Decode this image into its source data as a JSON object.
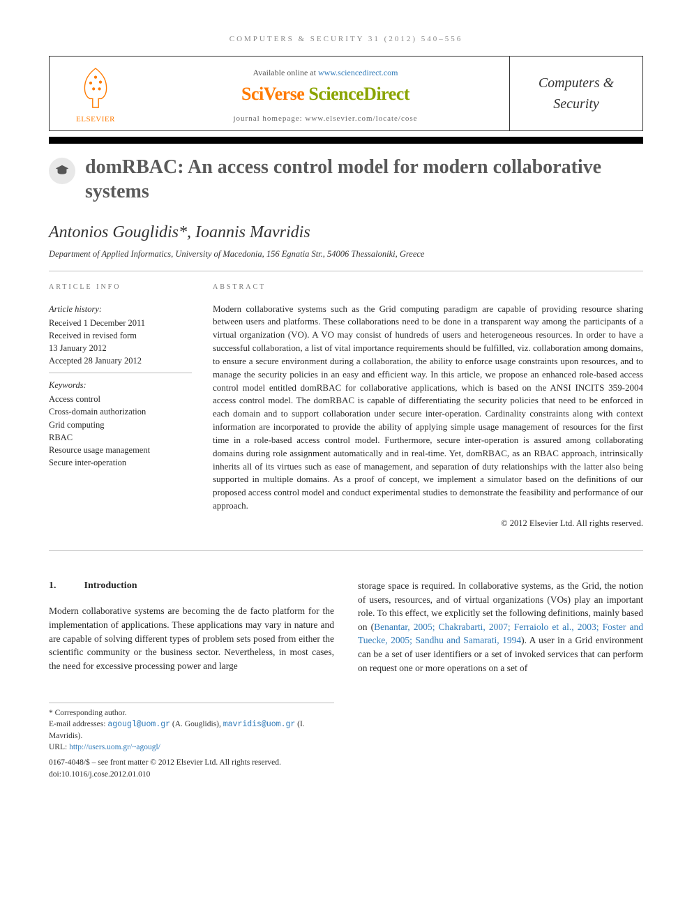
{
  "running_head": "COMPUTERS & SECURITY 31 (2012) 540–556",
  "header": {
    "available_prefix": "Available online at ",
    "available_link": "www.sciencedirect.com",
    "brand_left": "SciVerse ",
    "brand_right": "ScienceDirect",
    "homepage": "journal homepage: www.elsevier.com/locate/cose",
    "publisher_label": "ELSEVIER",
    "journal_name": "Computers & Security"
  },
  "title": "domRBAC: An access control model for modern collaborative systems",
  "authors_line": "Antonios Gouglidis*, Ioannis Mavridis",
  "affiliation": "Department of Applied Informatics, University of Macedonia, 156 Egnatia Str., 54006 Thessaloniki, Greece",
  "labels": {
    "article_info": "ARTICLE INFO",
    "abstract": "ABSTRACT",
    "history": "Article history:",
    "keywords": "Keywords:"
  },
  "history": {
    "received": "Received 1 December 2011",
    "revised_label": "Received in revised form",
    "revised_date": "13 January 2012",
    "accepted": "Accepted 28 January 2012"
  },
  "keywords": [
    "Access control",
    "Cross-domain authorization",
    "Grid computing",
    "RBAC",
    "Resource usage management",
    "Secure inter-operation"
  ],
  "abstract": "Modern collaborative systems such as the Grid computing paradigm are capable of providing resource sharing between users and platforms. These collaborations need to be done in a transparent way among the participants of a virtual organization (VO). A VO may consist of hundreds of users and heterogeneous resources. In order to have a successful collaboration, a list of vital importance requirements should be fulfilled, viz. collaboration among domains, to ensure a secure environment during a collaboration, the ability to enforce usage constraints upon resources, and to manage the security policies in an easy and efficient way. In this article, we propose an enhanced role-based access control model entitled domRBAC for collaborative applications, which is based on the ANSI INCITS 359-2004 access control model. The domRBAC is capable of differentiating the security policies that need to be enforced in each domain and to support collaboration under secure inter-operation. Cardinality constraints along with context information are incorporated to provide the ability of applying simple usage management of resources for the first time in a role-based access control model. Furthermore, secure inter-operation is assured among collaborating domains during role assignment automatically and in real-time. Yet, domRBAC, as an RBAC approach, intrinsically inherits all of its virtues such as ease of management, and separation of duty relationships with the latter also being supported in multiple domains. As a proof of concept, we implement a simulator based on the definitions of our proposed access control model and conduct experimental studies to demonstrate the feasibility and performance of our approach.",
  "abstract_copyright": "© 2012 Elsevier Ltd. All rights reserved.",
  "section": {
    "num": "1.",
    "title": "Introduction"
  },
  "body": {
    "left": "Modern collaborative systems are becoming the de facto platform for the implementation of applications. These applications may vary in nature and are capable of solving different types of problem sets posed from either the scientific community or the business sector. Nevertheless, in most cases, the need for excessive processing power and large",
    "right_a": "storage space is required. In collaborative systems, as the Grid, the notion of users, resources, and of virtual organizations (VOs) play an important role. To this effect, we explicitly set the following definitions, mainly based on (",
    "right_cite": "Benantar, 2005; Chakrabarti, 2007; Ferraiolo et al., 2003; Foster and Tuecke, 2005; Sandhu and Samarati, 1994",
    "right_b": "). A user in a Grid environment can be a set of user identifiers or a set of invoked services that can perform on request one or more operations on a set of"
  },
  "footnotes": {
    "corresponding": "* Corresponding author.",
    "emails_label": "E-mail addresses: ",
    "email1": "agougl@uom.gr",
    "email1_name": " (A. Gouglidis), ",
    "email2": "mavridis@uom.gr",
    "email2_name": " (I. Mavridis).",
    "url_label": "URL: ",
    "url": "http://users.uom.gr/~agougl/"
  },
  "footer": {
    "line1": "0167-4048/$ – see front matter © 2012 Elsevier Ltd. All rights reserved.",
    "line2": "doi:10.1016/j.cose.2012.01.010"
  }
}
